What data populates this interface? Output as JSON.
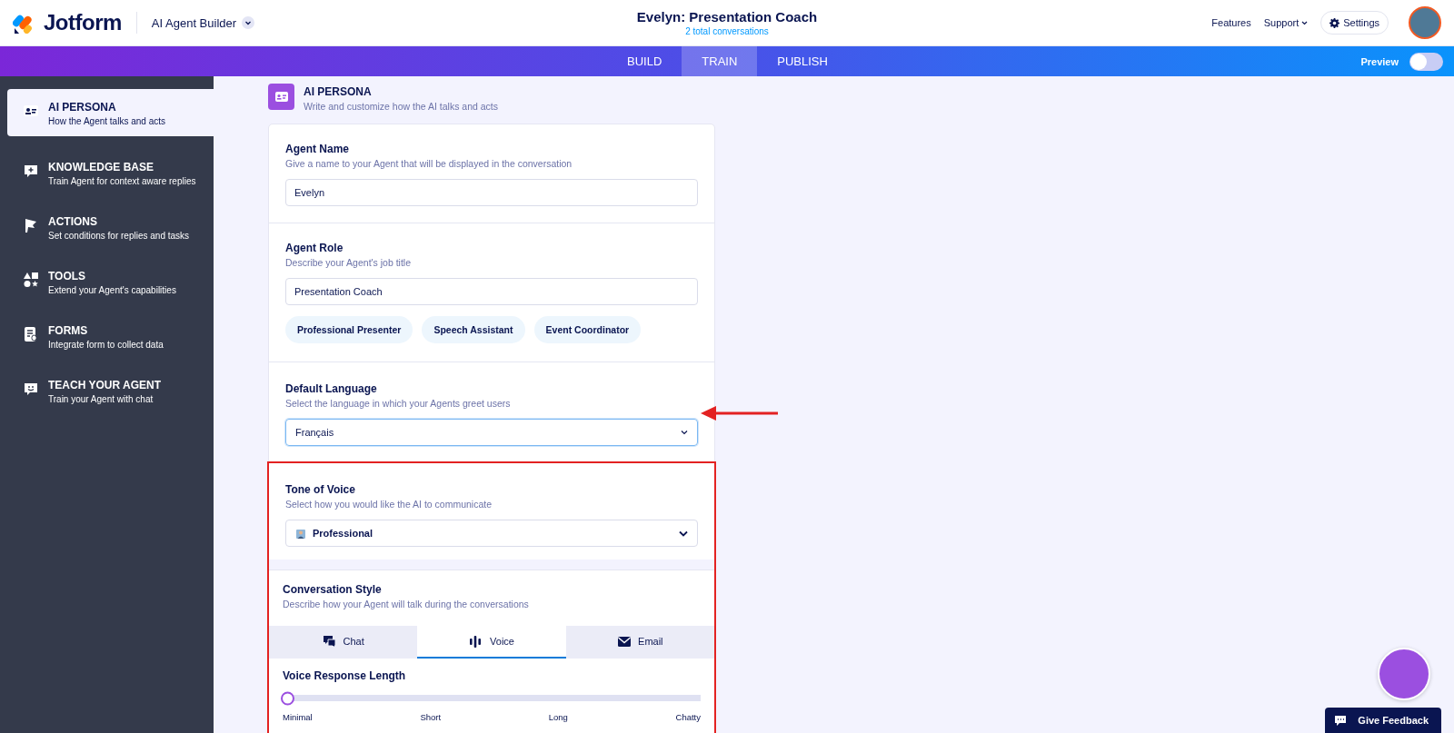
{
  "header": {
    "logo": "Jotform",
    "product": "AI Agent Builder",
    "title": "Evelyn: Presentation Coach",
    "subtitle": "2 total conversations",
    "links": [
      "Features",
      "Support"
    ],
    "settings": "Settings"
  },
  "nav_tabs": [
    {
      "label": "BUILD",
      "selected": false
    },
    {
      "label": "TRAIN",
      "selected": true
    },
    {
      "label": "PUBLISH",
      "selected": false
    }
  ],
  "preview": {
    "label": "Preview",
    "on": false
  },
  "sidebar": {
    "items": [
      {
        "title": "AI PERSONA",
        "subtitle": "How the Agent talks and acts",
        "selected": true
      },
      {
        "title": "KNOWLEDGE BASE",
        "subtitle": "Train Agent for context aware replies",
        "selected": false
      },
      {
        "title": "ACTIONS",
        "subtitle": "Set conditions for replies and tasks",
        "selected": false
      },
      {
        "title": "TOOLS",
        "subtitle": "Extend your Agent's capabilities",
        "selected": false
      },
      {
        "title": "FORMS",
        "subtitle": "Integrate form to collect data",
        "selected": false
      },
      {
        "title": "TEACH YOUR AGENT",
        "subtitle": "Train your Agent with chat",
        "selected": false
      }
    ]
  },
  "section": {
    "title": "AI PERSONA",
    "subtitle": "Write and customize how the AI talks and acts"
  },
  "agent_name": {
    "label": "Agent Name",
    "hint": "Give a name to your Agent that will be displayed in the conversation",
    "value": "Evelyn"
  },
  "agent_role": {
    "label": "Agent Role",
    "hint": "Describe your Agent's job title",
    "value": "Presentation Coach",
    "suggestions": [
      "Professional Presenter",
      "Speech Assistant",
      "Event Coordinator"
    ]
  },
  "default_language": {
    "label": "Default Language",
    "hint": "Select the language in which your Agents greet users",
    "value": "Français"
  },
  "tone_of_voice": {
    "label": "Tone of Voice",
    "hint": "Select how you would like the AI to communicate",
    "value": "Professional"
  },
  "conversation_style": {
    "label": "Conversation Style",
    "hint": "Describe how your Agent will talk during the conversations",
    "tabs": [
      {
        "label": "Chat",
        "selected": false
      },
      {
        "label": "Voice",
        "selected": true
      },
      {
        "label": "Email",
        "selected": false
      }
    ],
    "voice_response_length": {
      "label": "Voice Response Length",
      "level": 0,
      "stops": [
        "Minimal",
        "Short",
        "Long",
        "Chatty"
      ]
    }
  },
  "feedback_button": "Give Feedback"
}
